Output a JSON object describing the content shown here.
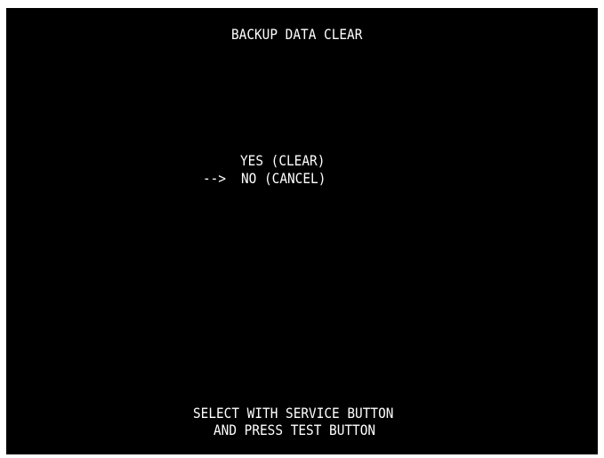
{
  "screen": {
    "title": "BACKUP DATA CLEAR",
    "options": [
      {
        "label": "YES (CLEAR)",
        "selected": false
      },
      {
        "label": "NO (CANCEL)",
        "selected": true
      }
    ],
    "cursor": "-->",
    "instructions": [
      "SELECT WITH SERVICE BUTTON",
      "AND PRESS TEST BUTTON"
    ],
    "colors": {
      "background": "#000000",
      "text": "#ffffff"
    }
  }
}
